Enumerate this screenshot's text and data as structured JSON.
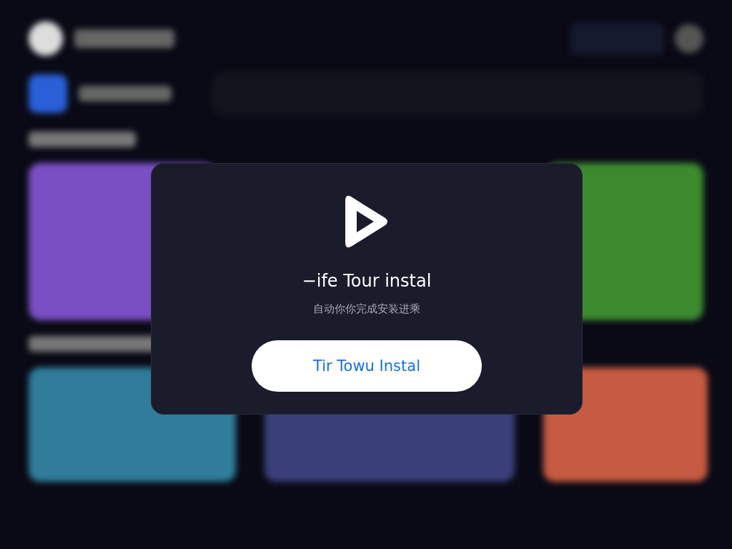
{
  "dialog": {
    "title": "−ife Tour instal",
    "subtitle": "自动你你完成安装进乘",
    "button": "Tir Towu Instal"
  }
}
